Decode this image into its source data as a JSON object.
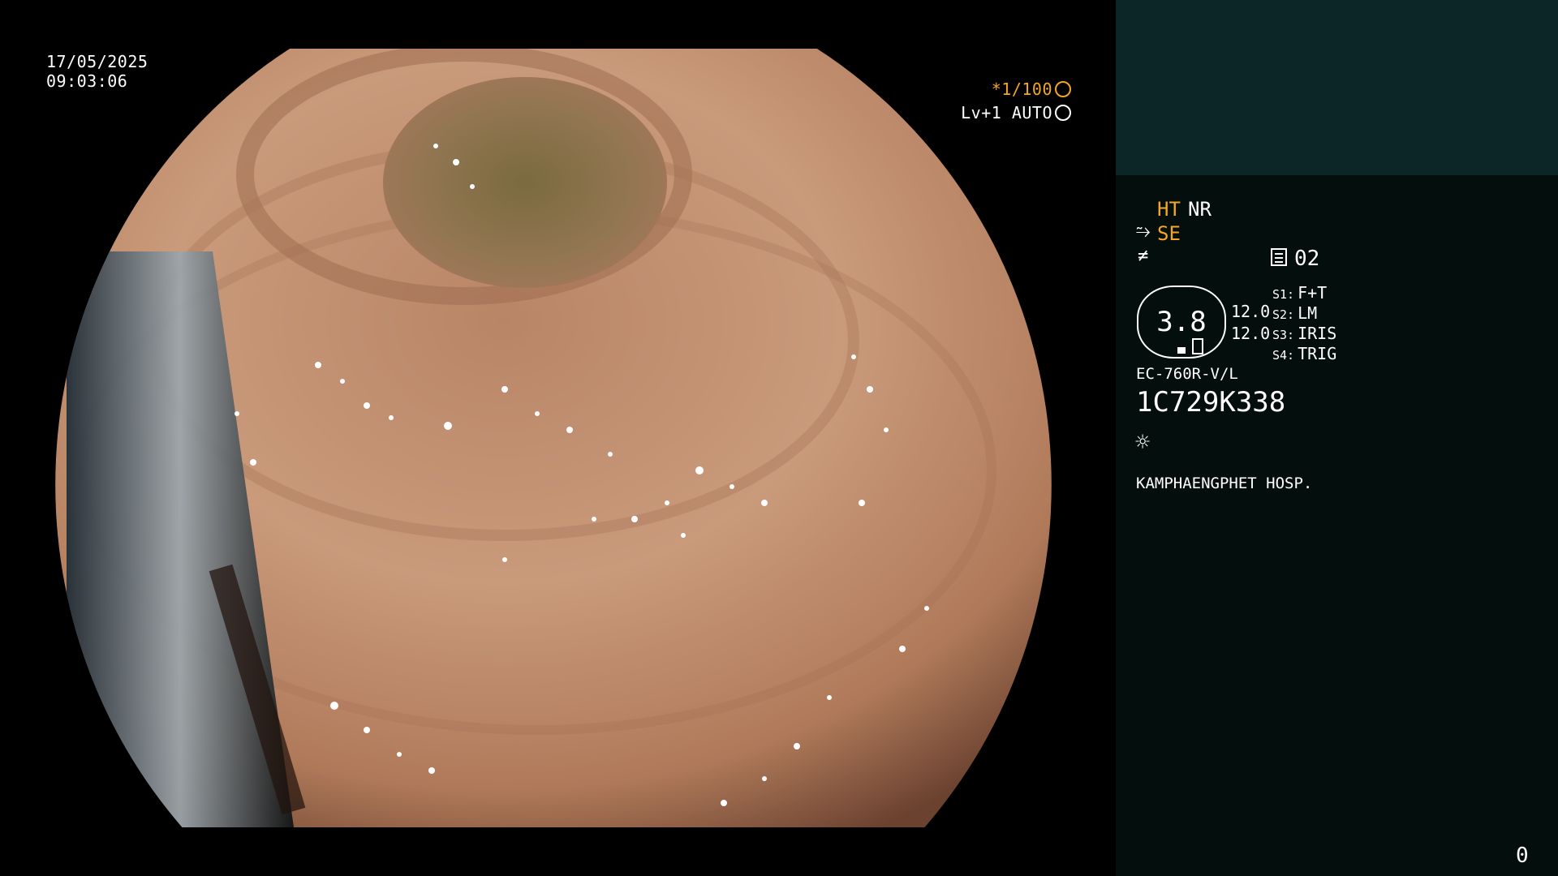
{
  "overlay": {
    "date": "17/05/2025",
    "time": "09:03:06",
    "shutter": "*1/100",
    "level": "Lv+1 AUTO"
  },
  "panel": {
    "ht": "HT",
    "nr": "NR",
    "se": "SE",
    "record_count": "02",
    "zoom": "3.8",
    "value_a": "12.0",
    "value_b": "12.0",
    "switches": [
      {
        "key": "S1:",
        "value": "F+T"
      },
      {
        "key": "S2:",
        "value": "LM"
      },
      {
        "key": "S3:",
        "value": "IRIS"
      },
      {
        "key": "S4:",
        "value": "TRIG"
      }
    ],
    "scope_model": "EC-760R-V/L",
    "serial": "1C729K338",
    "hospital": "KAMPHAENGPHET HOSP.",
    "page_count": "0"
  },
  "colors": {
    "accent": "#f5a623",
    "panel_bg": "#040e0c",
    "panel_top_bg": "#0c2526",
    "tissue": "#c7906f"
  },
  "icons": [
    "shutter-icon",
    "auto-iris-icon",
    "se-icon",
    "freeze-icon",
    "record-icon",
    "zoom-badge-icon",
    "light-source-icon"
  ]
}
